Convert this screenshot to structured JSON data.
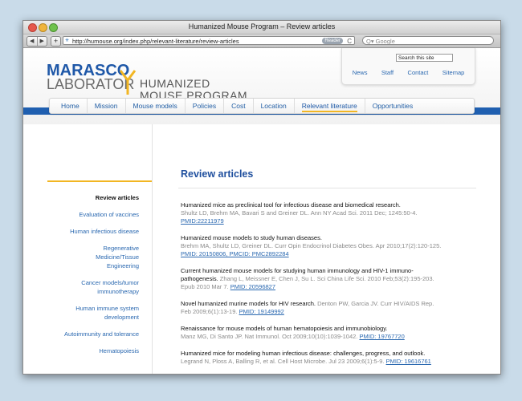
{
  "browser": {
    "window_title": "Humanized Mouse Program – Review articles",
    "back": "◀",
    "forward": "▶",
    "add": "+",
    "url": "http://humouse.org/index.php/relevant-literature/review-articles",
    "reader": "Reader",
    "reload": "C",
    "search_placeholder": "Q▾ Google"
  },
  "site": {
    "logo_marasco": "MARASCO",
    "logo_laboratory": "LABORATOR",
    "title_line1": "HUMANIZED",
    "title_line2": "MOUSE PROGRAM",
    "search_placeholder": "Search this site",
    "util_links": [
      "News",
      "Staff",
      "Contact",
      "Sitemap"
    ],
    "nav": [
      "Home",
      "Mission",
      "Mouse models",
      "Policies",
      "Cost",
      "Location",
      "Relevant literature",
      "Opportunities"
    ],
    "nav_active": "Relevant literature"
  },
  "sidebar": {
    "items": [
      {
        "label": "Review articles",
        "selected": true
      },
      {
        "label": "Evaluation of vaccines"
      },
      {
        "label": "Human infectious disease"
      },
      {
        "label": "Regenerative Medicine/Tissue Engineering"
      },
      {
        "label": "Cancer models/tumor immunotherapy"
      },
      {
        "label": "Human immune system development"
      },
      {
        "label": "Autoimmunity and tolerance"
      },
      {
        "label": "Hematopoiesis"
      }
    ]
  },
  "main": {
    "heading": "Review articles",
    "articles": [
      {
        "title": "Humanized mice as preclinical tool for infectious disease and biomedical research.",
        "citation": "Shultz LD, Brehm MA, Bavari S and Greiner DL.  Ann NY Acad Sci. 2011 Dec; 1245:50-4.",
        "links": "PMID:22211979"
      },
      {
        "title": "Humanized mouse models to study human diseases.",
        "citation": "Brehm MA, Shultz LD, Greiner DL. Curr Opin Endocrinol Diabetes Obes. Apr 2010;17(2):120-125.",
        "links": "PMID: 20150806, PMCID: PMC2892284"
      },
      {
        "title": "Current humanized mouse models for studying human immunology and HIV-1 immuno-pathogenesis.",
        "citation": "Zhang L, Meissner E, Chen J, Su L. Sci China Life Sci.  2010 Feb;53(2):195-203. Epub 2010 Mar 7.",
        "links": "PMID: 20596827"
      },
      {
        "title": "Novel humanized murine models for HIV research.",
        "citation": "Denton PW, Garcia JV. Curr HIV/AIDS Rep. Feb 2009;6(1):13-19.",
        "links": "PMID: 19149992"
      },
      {
        "title": "Renaissance for mouse models of human hematopoiesis and immunobiology.",
        "citation": "Manz MG, Di Santo JP. Nat Immunol. Oct 2009;10(10):1039-1042.",
        "links": "PMID: 19767720"
      },
      {
        "title": "Humanized mice for modeling human infectious disease: challenges, progress, and outlook.",
        "citation": "Legrand N, Ploss A, Balling R, et al. Cell Host Microbe. Jul 23 2009;6(1):5-9.",
        "links": "PMID: 19616761"
      }
    ]
  },
  "colors": {
    "brand_blue": "#1f5fb0",
    "accent_gold": "#f2b623",
    "link": "#2a68b0"
  }
}
